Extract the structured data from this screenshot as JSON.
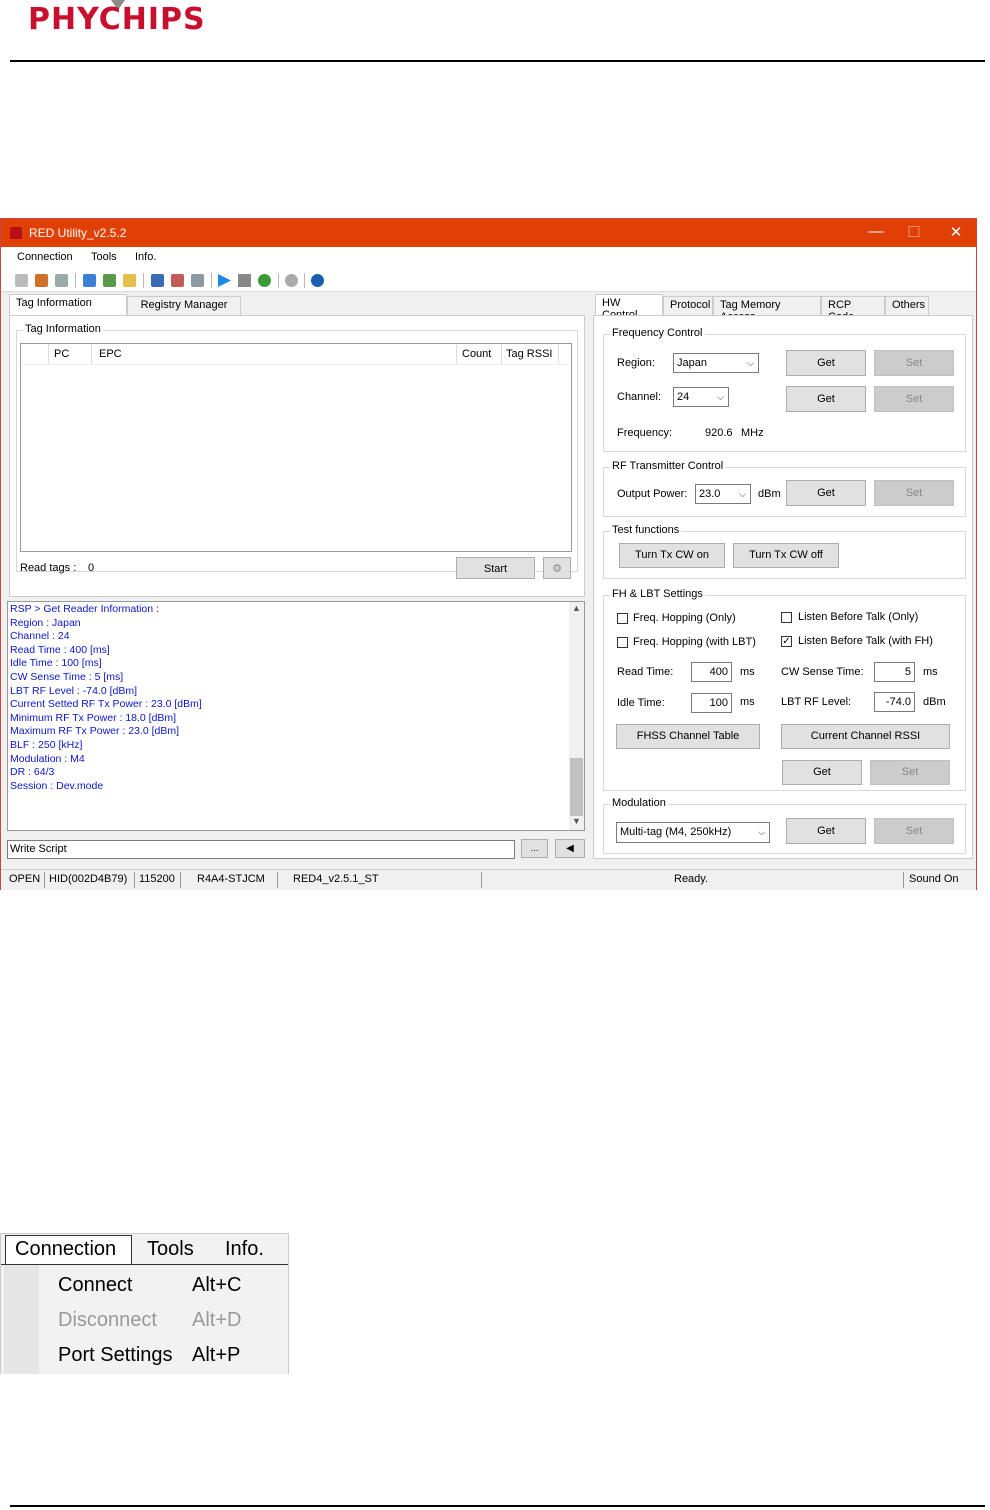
{
  "header": {
    "logo_text": "PHYCHIPS"
  },
  "window": {
    "title": "RED Utility_v2.5.2",
    "controls": {
      "minimize": "—",
      "maximize": "☐",
      "close": "✕"
    },
    "menu": [
      "Connection",
      "Tools",
      "Info."
    ],
    "left_tabs": [
      "Tag Information",
      "Registry Manager"
    ],
    "tag_info": {
      "group_title": "Tag Information",
      "columns": [
        "PC",
        "EPC",
        "Count",
        "Tag RSSI"
      ],
      "read_tags_label": "Read tags :",
      "read_tags_value": "0",
      "start_button": "Start"
    },
    "log_lines": [
      "RSP > Get Reader Information :",
      "Region : Japan",
      "Channel : 24",
      "Read Time : 400 [ms]",
      "Idle Time : 100 [ms]",
      "CW Sense Time : 5 [ms]",
      "LBT RF Level : -74.0 [dBm]",
      "Current Setted RF Tx Power : 23.0 [dBm]",
      "Minimum RF Tx Power : 18.0 [dBm]",
      "Maximum RF Tx Power : 23.0 [dBm]",
      "BLF : 250 [kHz]",
      "Modulation : M4",
      "DR :  64/3",
      "Session : Dev.mode"
    ],
    "script": {
      "value": "Write Script",
      "browse_button": "...",
      "run_button": "◀"
    },
    "right_tabs": [
      "HW Control",
      "Protocol",
      "Tag Memory Access",
      "RCP Code",
      "Others"
    ],
    "frequency_control": {
      "title": "Frequency Control",
      "region_label": "Region:",
      "region_value": "Japan",
      "channel_label": "Channel:",
      "channel_value": "24",
      "frequency_label": "Frequency:",
      "frequency_value": "920.6",
      "frequency_unit": "MHz",
      "get": "Get",
      "set": "Set"
    },
    "rf_transmitter": {
      "title": "RF Transmitter  Control",
      "output_power_label": "Output Power:",
      "output_power_value": "23.0",
      "unit": "dBm",
      "get": "Get",
      "set": "Set"
    },
    "test_functions": {
      "title": "Test functions",
      "cw_on": "Turn Tx CW on",
      "cw_off": "Turn Tx CW off"
    },
    "fh_lbt": {
      "title": "FH & LBT Settings",
      "freq_hopping_only": "Freq. Hopping (Only)",
      "freq_hopping_lbt": "Freq. Hopping (with LBT)",
      "lbt_only": "Listen Before Talk (Only)",
      "lbt_fh": "Listen Before Talk (with FH)",
      "lbt_fh_checked": "✓",
      "read_time_label": "Read Time:",
      "read_time_value": "400",
      "idle_time_label": "Idle Time:",
      "idle_time_value": "100",
      "cw_sense_label": "CW Sense Time:",
      "cw_sense_value": "5",
      "lbt_rf_label": "LBT RF Level:",
      "lbt_rf_value": "-74.0",
      "ms": "ms",
      "dbm": "dBm",
      "fhss_button": "FHSS Channel Table",
      "rssi_button": "Current Channel RSSI",
      "get": "Get",
      "set": "Set"
    },
    "modulation": {
      "title": "Modulation",
      "value": "Multi-tag (M4, 250kHz)",
      "get": "Get",
      "set": "Set"
    },
    "status": {
      "state": "OPEN",
      "port": "HID(002D4B79)",
      "baud": "115200",
      "model": "R4A4-STJCM",
      "fw": "RED4_v2.5.1_ST",
      "ready": "Ready.",
      "sound": "Sound On"
    }
  },
  "menu_crop": {
    "bar": [
      "Connection",
      "Tools",
      "Info."
    ],
    "items": [
      {
        "label": "Connect",
        "shortcut": "Alt+C",
        "enabled": true
      },
      {
        "label": "Disconnect",
        "shortcut": "Alt+D",
        "enabled": false
      },
      {
        "label": "Port Settings",
        "shortcut": "Alt+P",
        "enabled": true
      }
    ]
  }
}
